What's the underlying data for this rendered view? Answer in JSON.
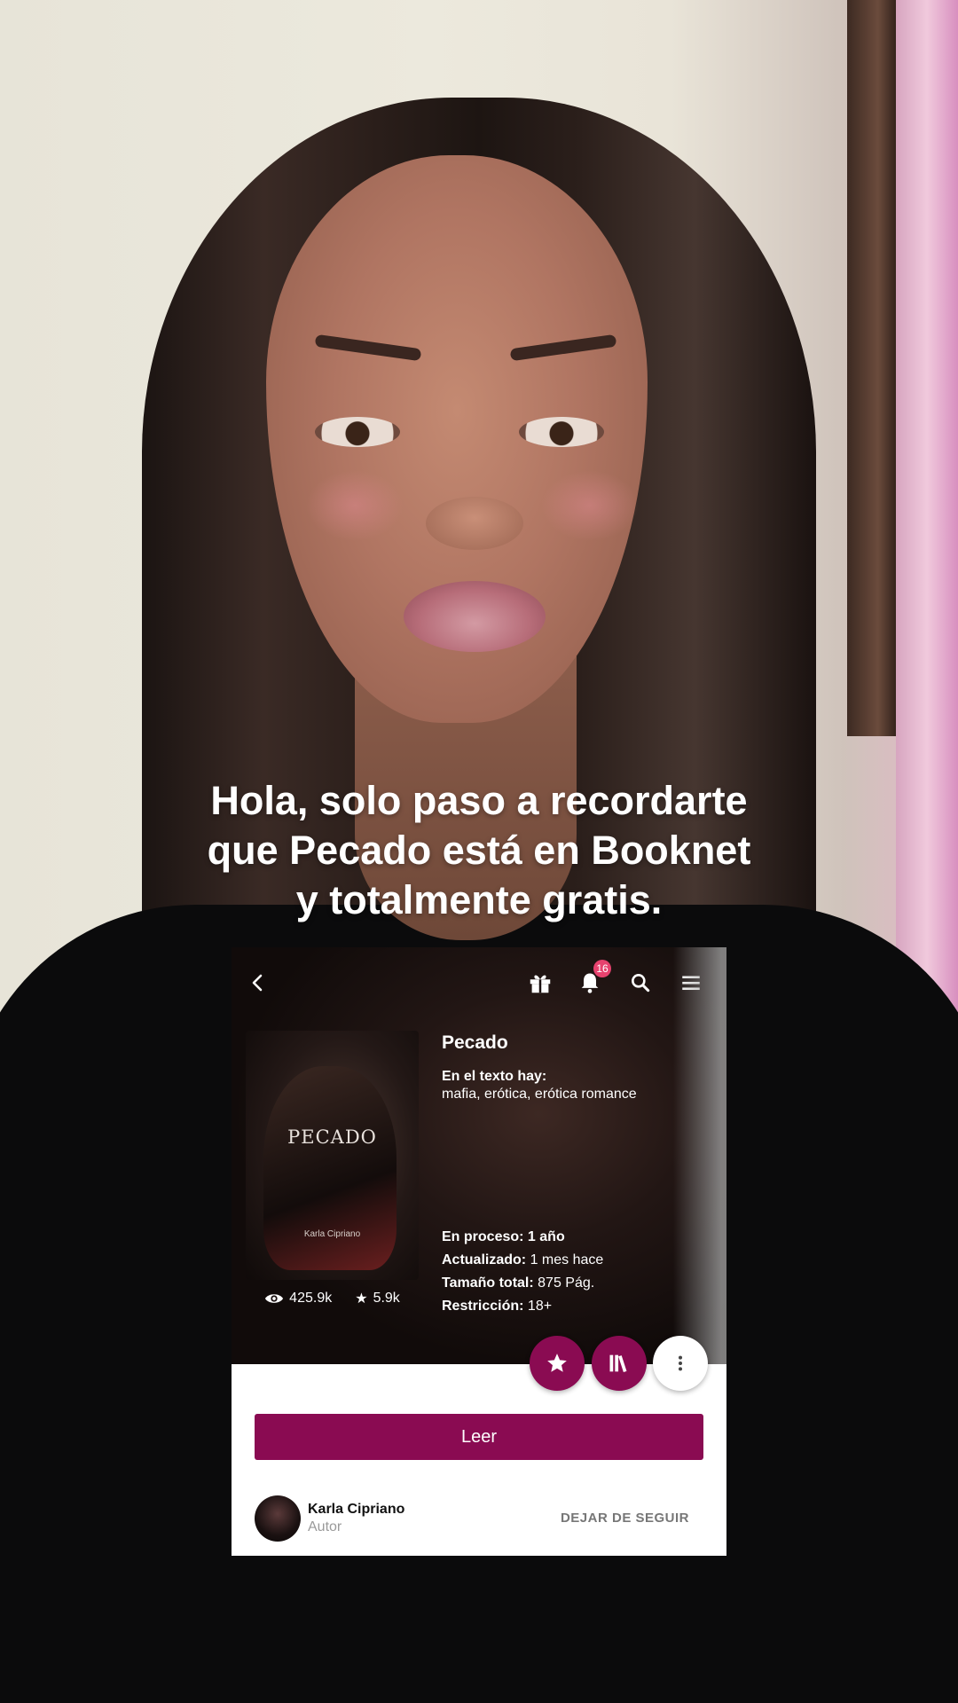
{
  "caption": {
    "line1": "Hola, solo paso a recordarte",
    "line2": "que Pecado está en Booknet",
    "line3": "y totalmente gratis."
  },
  "app": {
    "accent_color": "#8a0b52",
    "topbar": {
      "icons": [
        "back-icon",
        "gift-icon",
        "bell-icon",
        "search-icon",
        "menu-icon"
      ],
      "notification_count": "16"
    },
    "book": {
      "title": "Pecado",
      "cover_title": "PECADO",
      "cover_author": "Karla Cipriano",
      "views": "425.9k",
      "stars": "5.9k",
      "genres_label": "En el texto hay:",
      "genres": "mafia, erótica, erótica romance",
      "status_label": "En proceso:",
      "status_value": "1 año",
      "updated_label": "Actualizado:",
      "updated_value": "1 mes hace",
      "size_label": "Tamaño total:",
      "size_value": "875 Pág.",
      "restriction_label": "Restricción:",
      "restriction_value": "18+"
    },
    "read_button": "Leer",
    "author": {
      "name": "Karla Cipriano",
      "role": "Autor",
      "unfollow_label": "DEJAR DE SEGUIR"
    }
  }
}
